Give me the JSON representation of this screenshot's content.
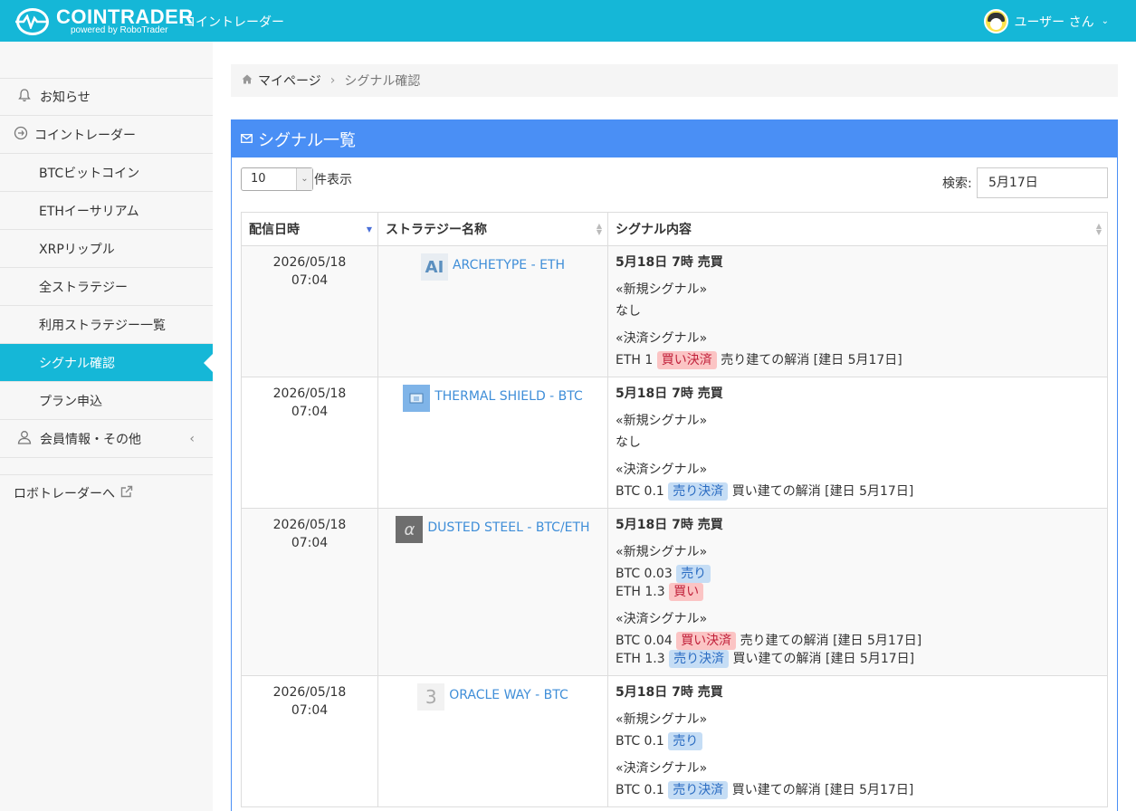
{
  "header": {
    "brand": "COINTRADER",
    "brand_sub": "powered by RoboTrader",
    "brand_jp": "コイントレーダー",
    "user_name": "ユーザー さん"
  },
  "sidebar": {
    "items": [
      {
        "label": "お知らせ",
        "icon": "bell-icon"
      },
      {
        "label": "コイントレーダー",
        "icon": "coin-icon"
      },
      {
        "label": "BTCビットコイン"
      },
      {
        "label": "ETHイーサリアム"
      },
      {
        "label": "XRPリップル"
      },
      {
        "label": "全ストラテジー"
      },
      {
        "label": "利用ストラテジー一覧"
      },
      {
        "label": "シグナル確認"
      },
      {
        "label": "プラン申込"
      },
      {
        "label": "会員情報・その他",
        "icon": "user-icon"
      }
    ],
    "external_link": "ロボトレーダーへ"
  },
  "breadcrumb": {
    "home": "マイページ",
    "current": "シグナル確認"
  },
  "panel": {
    "title": "シグナル一覧",
    "page_length": "10",
    "page_length_label": "件表示",
    "search_label": "検索:",
    "search_value": "5月17日"
  },
  "table": {
    "headers": [
      "配信日時",
      "ストラテジー名称",
      "シグナル内容"
    ],
    "rows": [
      {
        "date": "2026/05/18",
        "time": "07:04",
        "strategy": "ARCHETYPE - ETH",
        "thumb": "AI",
        "signal_title": "5月18日 7時 売買",
        "new_label": "«新規シグナル»",
        "new_lines": [
          {
            "text": "なし"
          }
        ],
        "settle_label": "«決済シグナル»",
        "settle_lines": [
          {
            "asset": "ETH 1",
            "tag": "買い決済",
            "tag_type": "buy",
            "note": "売り建ての解消 [建日 5月17日]"
          }
        ]
      },
      {
        "date": "2026/05/18",
        "time": "07:04",
        "strategy": "THERMAL SHIELD - BTC",
        "thumb": "",
        "signal_title": "5月18日 7時 売買",
        "new_label": "«新規シグナル»",
        "new_lines": [
          {
            "text": "なし"
          }
        ],
        "settle_label": "«決済シグナル»",
        "settle_lines": [
          {
            "asset": "BTC 0.1",
            "tag": "売り決済",
            "tag_type": "sell",
            "note": "買い建ての解消 [建日 5月17日]"
          }
        ]
      },
      {
        "date": "2026/05/18",
        "time": "07:04",
        "strategy": "DUSTED STEEL - BTC/ETH",
        "thumb": "α",
        "signal_title": "5月18日 7時 売買",
        "new_label": "«新規シグナル»",
        "new_lines": [
          {
            "asset": "BTC 0.03",
            "tag": "売り",
            "tag_type": "sell"
          },
          {
            "asset": "ETH 1.3",
            "tag": "買い",
            "tag_type": "buy"
          }
        ],
        "settle_label": "«決済シグナル»",
        "settle_lines": [
          {
            "asset": "BTC 0.04",
            "tag": "買い決済",
            "tag_type": "buy",
            "note": "売り建ての解消 [建日 5月17日]"
          },
          {
            "asset": "ETH 1.3",
            "tag": "売り決済",
            "tag_type": "sell",
            "note": "買い建ての解消 [建日 5月17日]"
          }
        ]
      },
      {
        "date": "2026/05/18",
        "time": "07:04",
        "strategy": "ORACLE WAY - BTC",
        "thumb": "3",
        "signal_title": "5月18日 7時 売買",
        "new_label": "«新規シグナル»",
        "new_lines": [
          {
            "asset": "BTC 0.1",
            "tag": "売り",
            "tag_type": "sell"
          }
        ],
        "settle_label": "«決済シグナル»",
        "settle_lines": [
          {
            "asset": "BTC 0.1",
            "tag": "売り決済",
            "tag_type": "sell",
            "note": "買い建ての解消 [建日 5月17日]"
          }
        ]
      }
    ]
  },
  "colors": {
    "header": "#15b7d7",
    "panel": "#4a8ff5",
    "link": "#3f8ed8",
    "buy_tag": "#fbc4c4",
    "sell_tag": "#c5ddf5"
  }
}
